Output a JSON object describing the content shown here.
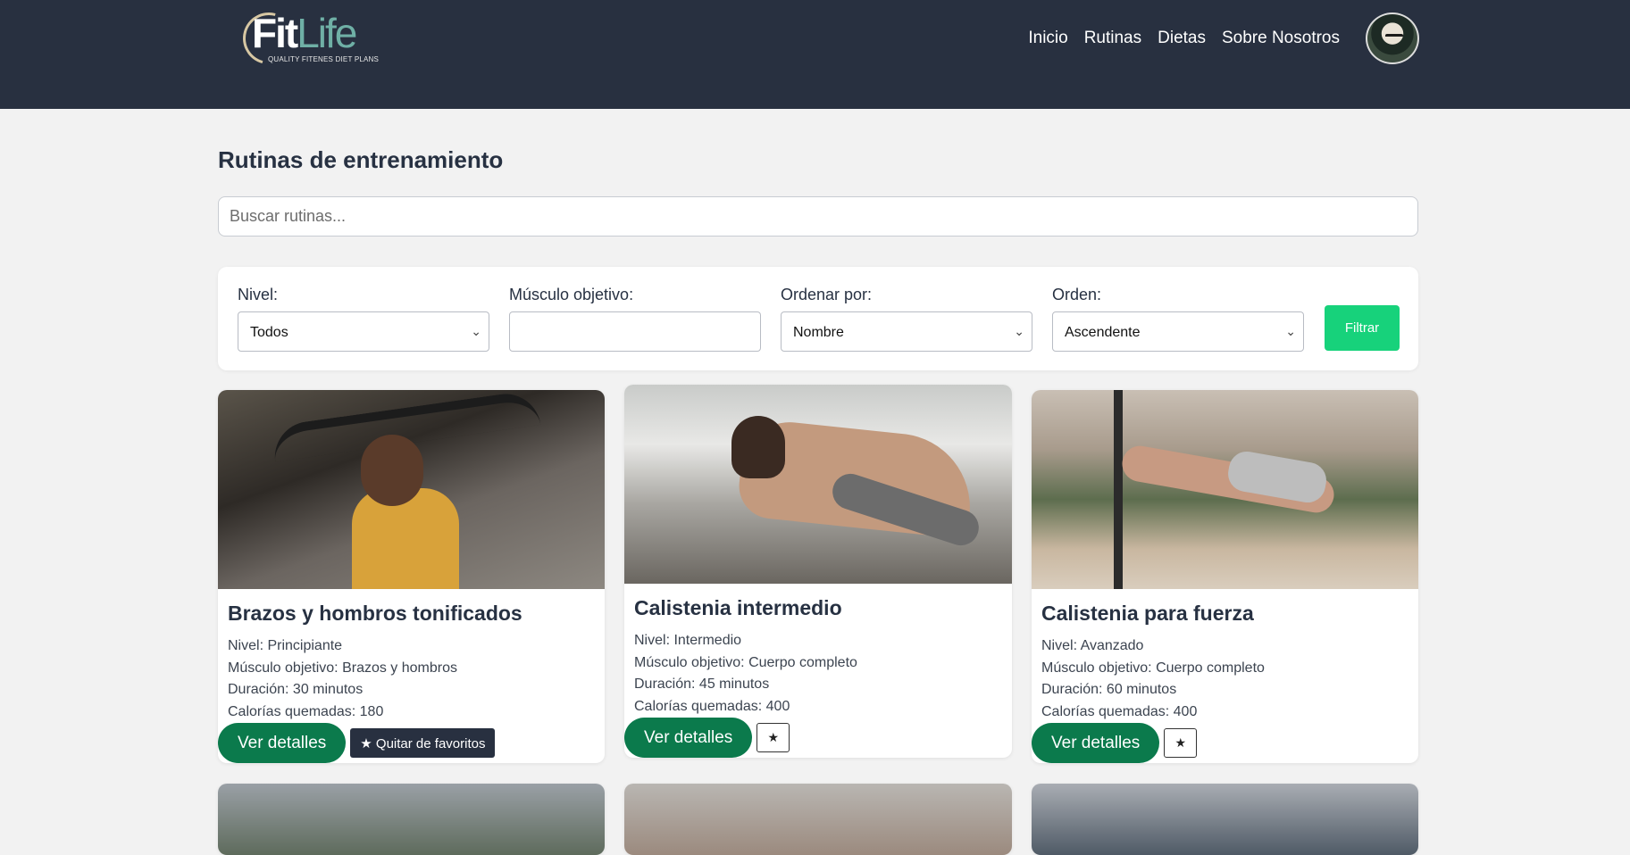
{
  "header": {
    "logo_main": "Fit",
    "logo_accent": "Life",
    "logo_tagline": "QUALITY FITENES DIET PLANS",
    "nav": [
      "Inicio",
      "Rutinas",
      "Dietas",
      "Sobre Nosotros"
    ]
  },
  "page": {
    "title": "Rutinas de entrenamiento",
    "search_placeholder": "Buscar rutinas..."
  },
  "filters": {
    "level_label": "Nivel:",
    "level_value": "Todos",
    "muscle_label": "Músculo objetivo:",
    "muscle_value": "",
    "sort_label": "Ordenar por:",
    "sort_value": "Nombre",
    "order_label": "Orden:",
    "order_value": "Ascendente",
    "button": "Filtrar"
  },
  "labels": {
    "level": "Nivel: ",
    "muscle": "Músculo objetivo: ",
    "duration": "Duración: ",
    "calories": "Calorías quemadas: ",
    "details": "Ver detalles",
    "remove_fav": "★ Quitar de favoritos",
    "star": "★"
  },
  "routines": [
    {
      "title": "Brazos y hombros tonificados",
      "level": "Principiante",
      "muscle": "Brazos y hombros",
      "duration": "30 minutos",
      "calories": "180"
    },
    {
      "title": "Calistenia intermedio",
      "level": "Intermedio",
      "muscle": "Cuerpo completo",
      "duration": "45 minutos",
      "calories": "400"
    },
    {
      "title": "Calistenia para fuerza",
      "level": "Avanzado",
      "muscle": "Cuerpo completo",
      "duration": "60 minutos",
      "calories": "400"
    }
  ],
  "colors": {
    "header_bg": "#283040",
    "accent_green": "#17d27b",
    "detail_button": "#0b7a4c",
    "logo_accent": "#6fb0a6"
  }
}
